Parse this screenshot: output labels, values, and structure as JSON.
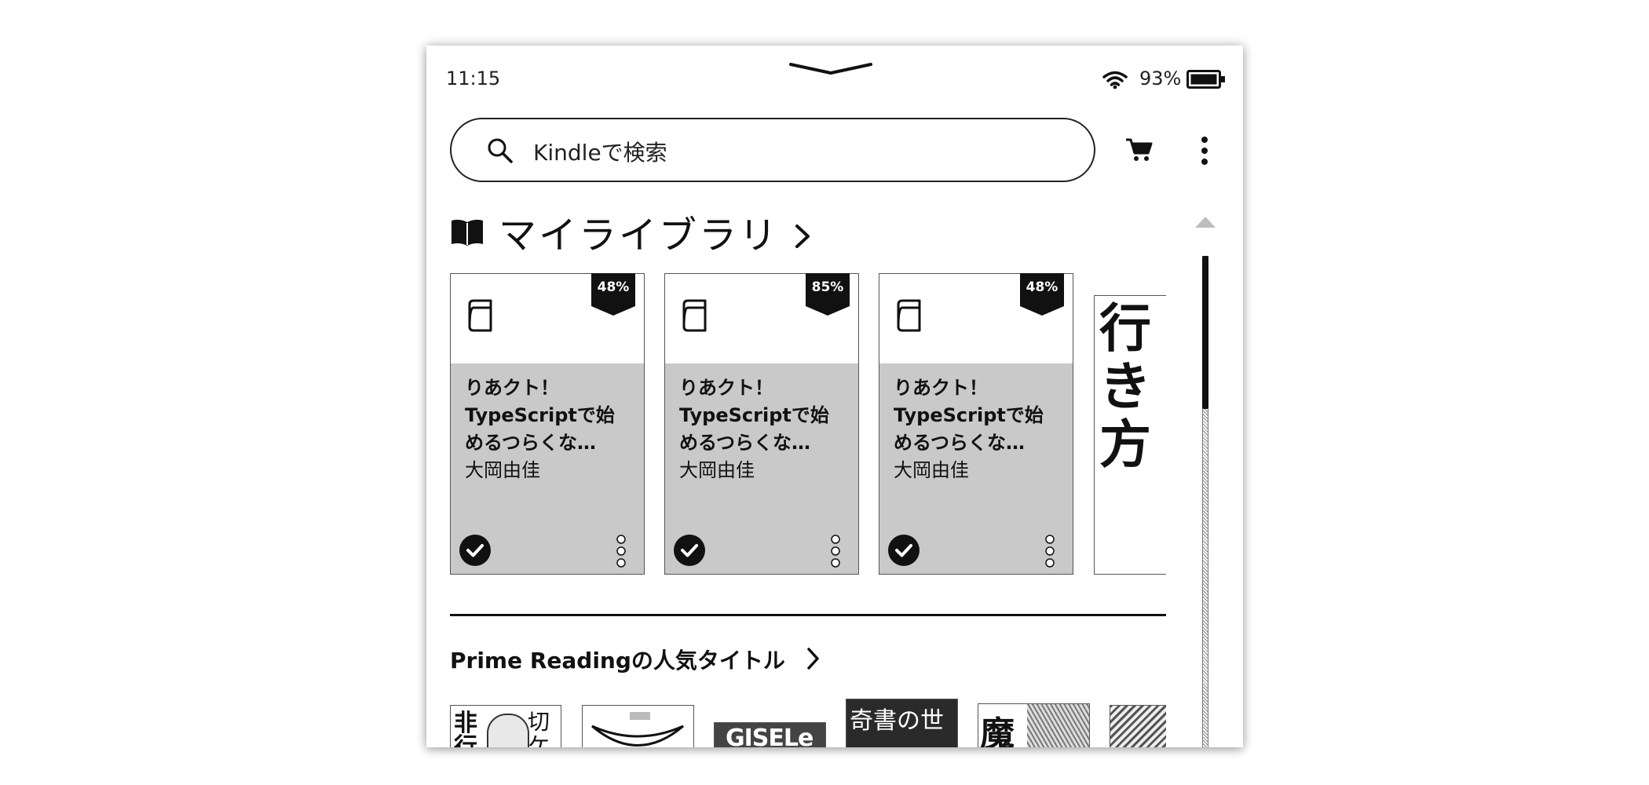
{
  "status": {
    "time": "11:15",
    "battery": "93%"
  },
  "search": {
    "placeholder": "Kindleで検索"
  },
  "library": {
    "title": "マイライブラリ",
    "books": [
      {
        "progress": "48%",
        "title_lines": [
          "りあクト！",
          "TypeScriptで始",
          "めるつらくな…"
        ],
        "author": "大岡由佳"
      },
      {
        "progress": "85%",
        "title_lines": [
          "りあクト！",
          "TypeScriptで始",
          "めるつらくな…"
        ],
        "author": "大岡由佳"
      },
      {
        "progress": "48%",
        "title_lines": [
          "りあクト！",
          "TypeScriptで始",
          "めるつらくな…"
        ],
        "author": "大岡由佳"
      }
    ],
    "partial_cover_text": [
      "行",
      "き",
      "方"
    ]
  },
  "prime": {
    "title": "Prime Readingの人気タイトル"
  },
  "thumbnail_texts": [
    "非行",
    "切ケ",
    "GISELe",
    "奇書の世",
    "魔"
  ],
  "icons": [
    "pull-handle-icon",
    "wifi-icon",
    "battery-icon",
    "search-icon",
    "cart-icon",
    "more-vert-icon",
    "book-open-icon",
    "chevron-right-icon",
    "book-icon",
    "check-circle-icon",
    "dots-vertical-icon",
    "scroll-up-icon"
  ]
}
